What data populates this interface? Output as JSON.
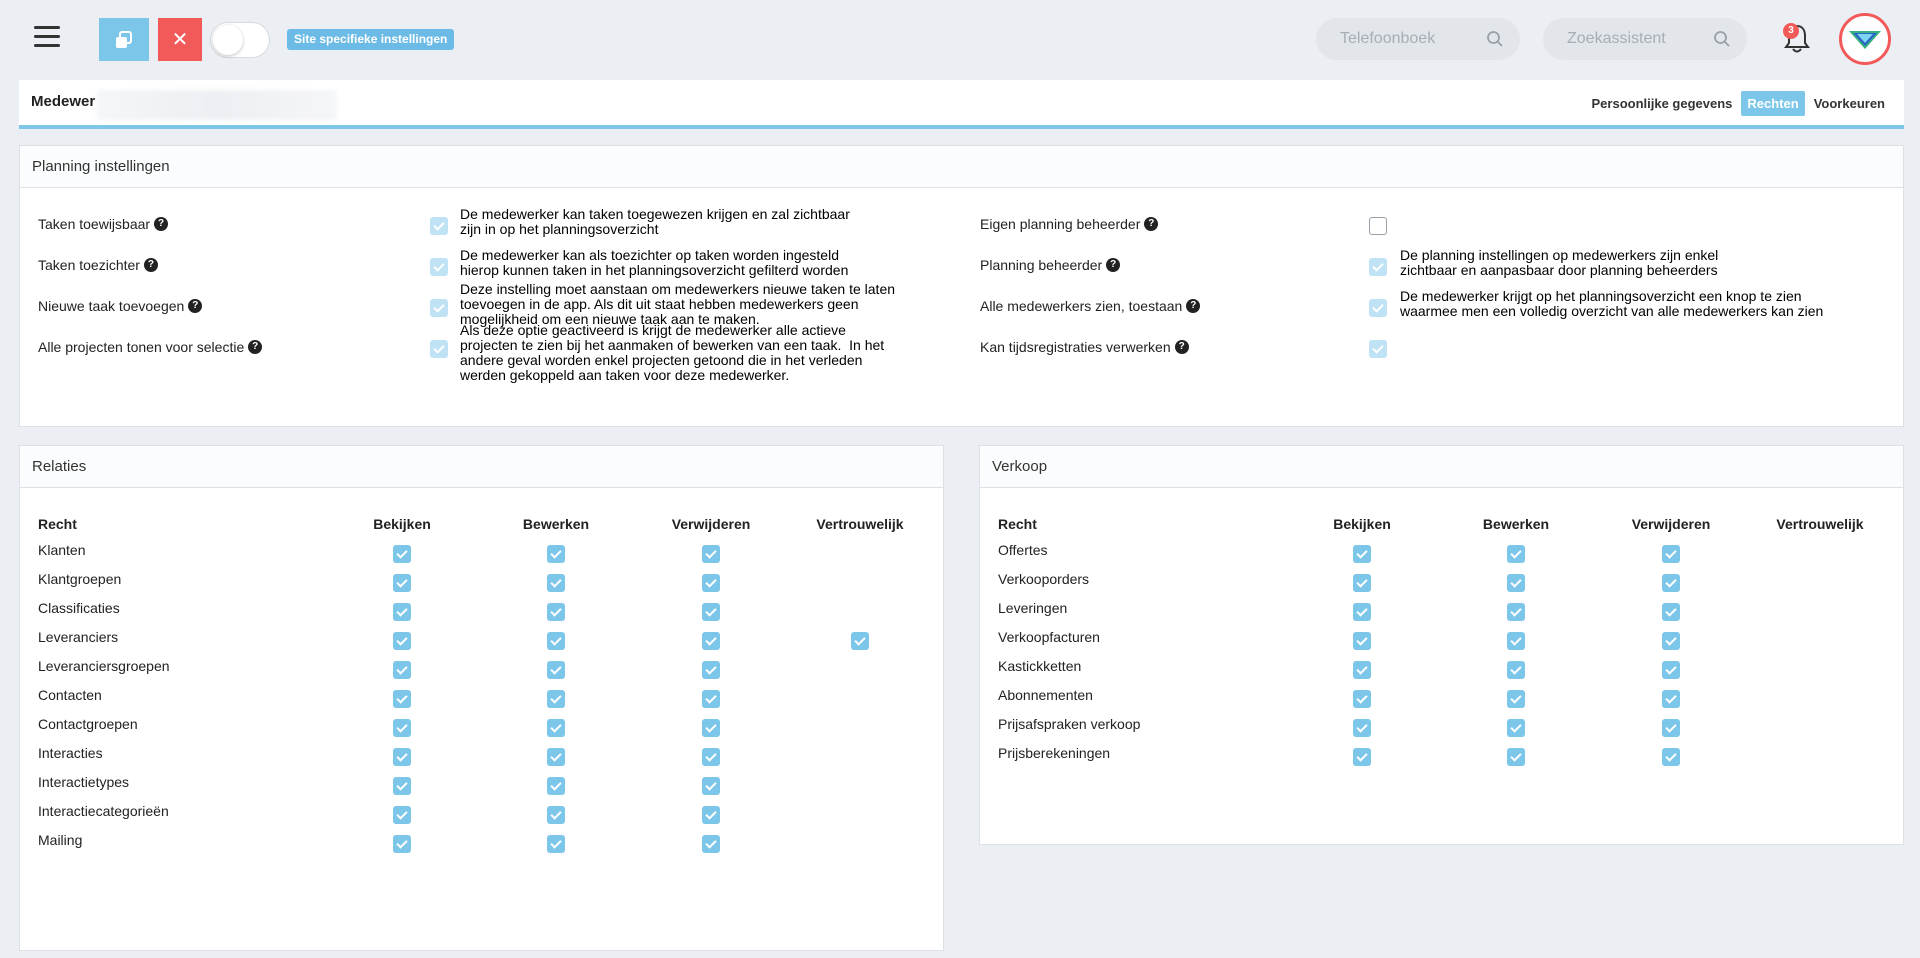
{
  "topbar": {
    "site_badge": "Site specifieke instellingen",
    "search1_placeholder": "Telefoonboek",
    "search2_placeholder": "Zoekassistent",
    "notification_count": "3",
    "accent": "#7cc6ea",
    "danger": "#f25a5a"
  },
  "employee": {
    "name_prefix": "Medewer",
    "tabs": [
      "Persoonlijke gegevens",
      "Rechten",
      "Voorkeuren"
    ],
    "active_tab": "Rechten"
  },
  "planning": {
    "title": "Planning instellingen",
    "left": [
      {
        "label": "Taken toewijsbaar",
        "checked": true,
        "desc": "De medewerker kan taken toegewezen krijgen en zal zichtbaar\nzijn in op het planningsoverzicht"
      },
      {
        "label": "Taken toezichter",
        "checked": true,
        "desc": "De medewerker kan als toezichter op taken worden ingesteld\nhierop kunnen taken in het planningsoverzicht gefilterd worden"
      },
      {
        "label": "Nieuwe taak toevoegen",
        "checked": true,
        "desc": "Deze instelling moet aanstaan om medewerkers nieuwe taken te laten\ntoevoegen in de app. Als dit uit staat hebben medewerkers geen\nmogelijkheid om een nieuwe taak aan te maken."
      },
      {
        "label": "Alle projecten tonen voor selectie",
        "checked": true,
        "desc": "Als deze optie geactiveerd is krijgt de medewerker alle actieve\nprojecten te zien bij het aanmaken of bewerken van een taak.  In het\nandere geval worden enkel projecten getoond die in het verleden\nwerden gekoppeld aan taken voor deze medewerker."
      }
    ],
    "right": [
      {
        "label": "Eigen planning beheerder",
        "checked": false,
        "desc": ""
      },
      {
        "label": "Planning beheerder",
        "checked": true,
        "desc": "De planning instellingen op medewerkers zijn enkel\nzichtbaar en aanpasbaar door planning beheerders"
      },
      {
        "label": "Alle medewerkers zien, toestaan",
        "checked": true,
        "desc": "De medewerker krijgt op het planningsoverzicht een knop te zien\nwaarmee men een volledig overzicht van alle medewerkers kan zien"
      },
      {
        "label": "Kan tijdsregistraties verwerken",
        "checked": true,
        "desc": ""
      }
    ]
  },
  "relaties": {
    "title": "Relaties",
    "headers": [
      "Recht",
      "Bekijken",
      "Bewerken",
      "Verwijderen",
      "Vertrouwelijk"
    ],
    "rows": [
      {
        "name": "Klanten",
        "v": [
          true,
          true,
          true,
          false
        ]
      },
      {
        "name": "Klantgroepen",
        "v": [
          true,
          true,
          true,
          false
        ]
      },
      {
        "name": "Classificaties",
        "v": [
          true,
          true,
          true,
          false
        ]
      },
      {
        "name": "Leveranciers",
        "v": [
          true,
          true,
          true,
          true
        ]
      },
      {
        "name": "Leveranciersgroepen",
        "v": [
          true,
          true,
          true,
          false
        ]
      },
      {
        "name": "Contacten",
        "v": [
          true,
          true,
          true,
          false
        ]
      },
      {
        "name": "Contactgroepen",
        "v": [
          true,
          true,
          true,
          false
        ]
      },
      {
        "name": "Interacties",
        "v": [
          true,
          true,
          true,
          false
        ]
      },
      {
        "name": "Interactietypes",
        "v": [
          true,
          true,
          true,
          false
        ]
      },
      {
        "name": "Interactiecategorieën",
        "v": [
          true,
          true,
          true,
          false
        ]
      },
      {
        "name": "Mailing",
        "v": [
          true,
          true,
          true,
          false
        ]
      }
    ]
  },
  "verkoop": {
    "title": "Verkoop",
    "headers": [
      "Recht",
      "Bekijken",
      "Bewerken",
      "Verwijderen",
      "Vertrouwelijk"
    ],
    "rows": [
      {
        "name": "Offertes",
        "v": [
          true,
          true,
          true,
          false
        ]
      },
      {
        "name": "Verkooporders",
        "v": [
          true,
          true,
          true,
          false
        ]
      },
      {
        "name": "Leveringen",
        "v": [
          true,
          true,
          true,
          false
        ]
      },
      {
        "name": "Verkoopfacturen",
        "v": [
          true,
          true,
          true,
          false
        ]
      },
      {
        "name": "Kastickketten",
        "v": [
          true,
          true,
          true,
          false
        ]
      },
      {
        "name": "Abonnementen",
        "v": [
          true,
          true,
          true,
          false
        ]
      },
      {
        "name": "Prijsafspraken verkoop",
        "v": [
          true,
          true,
          true,
          false
        ]
      },
      {
        "name": "Prijsberekeningen",
        "v": [
          true,
          true,
          true,
          false
        ]
      }
    ]
  }
}
